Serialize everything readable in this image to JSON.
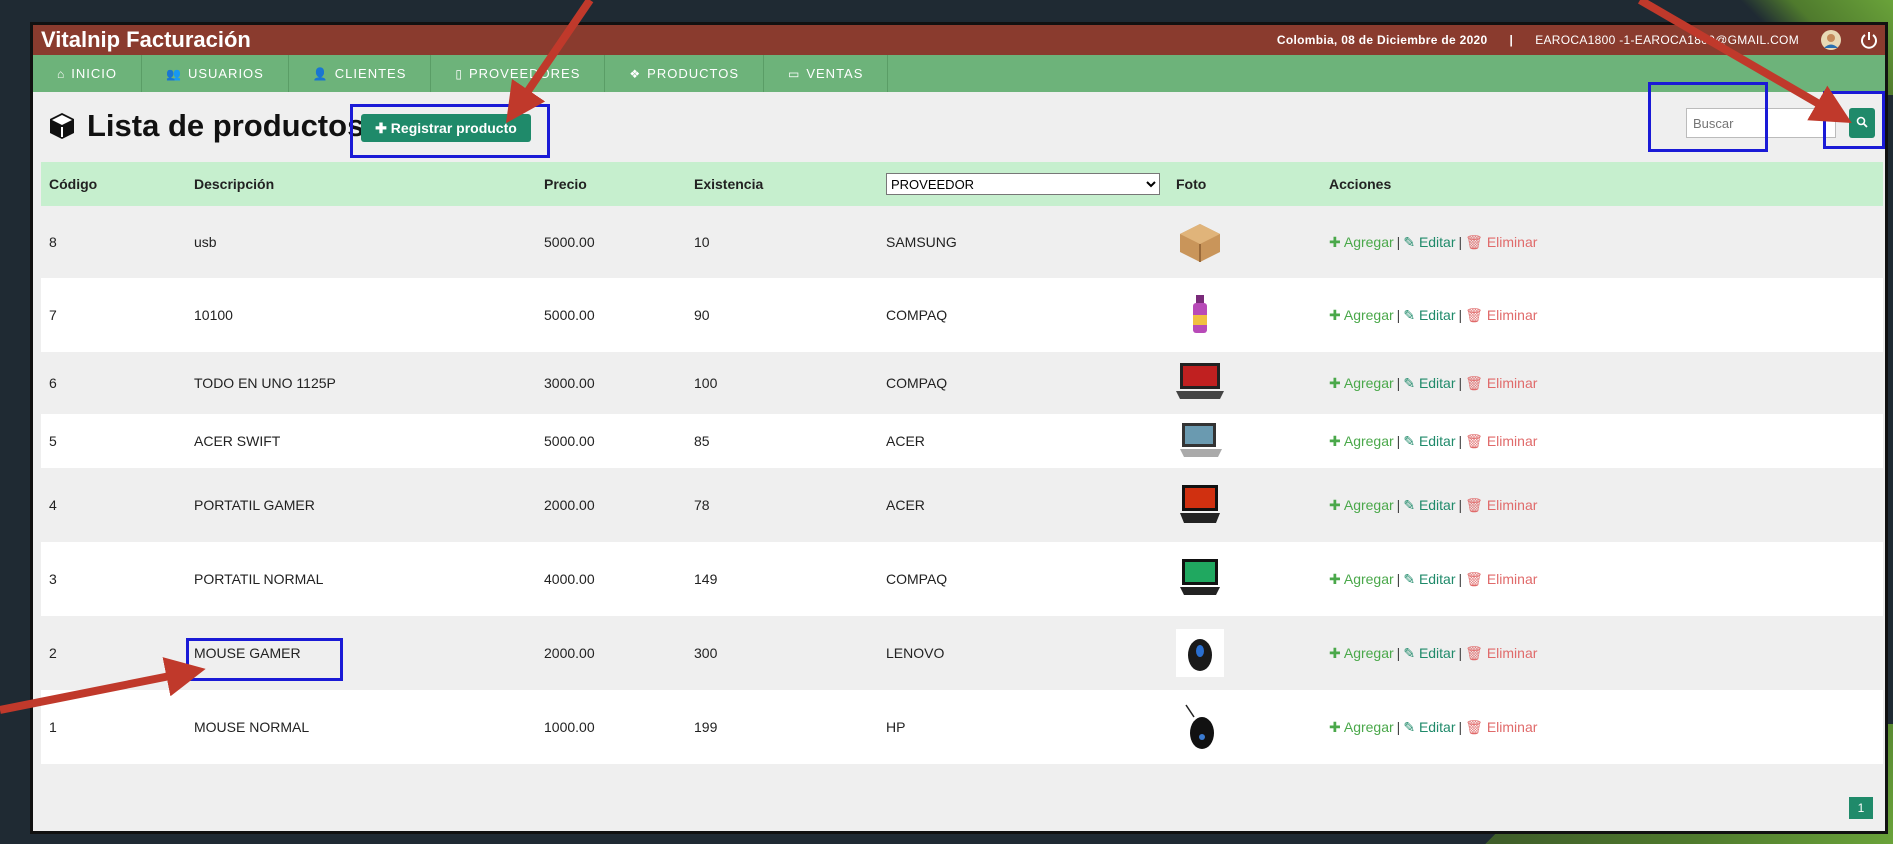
{
  "app": {
    "title": "Vitalnip Facturación",
    "date": "Colombia, 08 de Diciembre de 2020",
    "separator": "|",
    "user": "EAROCA1800 -1-EAROCA1800@GMAIL.COM"
  },
  "nav": [
    {
      "label": "INICIO",
      "icon": "home-icon"
    },
    {
      "label": "USUARIOS",
      "icon": "users-icon"
    },
    {
      "label": "CLIENTES",
      "icon": "user-icon"
    },
    {
      "label": "PROVEEDORES",
      "icon": "building-icon"
    },
    {
      "label": "PRODUCTOS",
      "icon": "cubes-icon"
    },
    {
      "label": "VENTAS",
      "icon": "file-icon"
    }
  ],
  "page": {
    "title": "Lista de productos",
    "register_label": "Registrar producto",
    "search_placeholder": "Buscar"
  },
  "table": {
    "headers": [
      "Código",
      "Descripción",
      "Precio",
      "Existencia",
      "Foto",
      "Acciones"
    ],
    "provider_filter": "PROVEEDOR",
    "actions": {
      "add": "Agregar",
      "edit": "Editar",
      "delete": "Eliminar",
      "sep": "|"
    },
    "rows": [
      {
        "code": "8",
        "description": "usb",
        "price": "5000.00",
        "stock": "10",
        "provider": "SAMSUNG",
        "photo": "cardboard-box"
      },
      {
        "code": "7",
        "description": "10100",
        "price": "5000.00",
        "stock": "90",
        "provider": "COMPAQ",
        "photo": "bottle"
      },
      {
        "code": "6",
        "description": "TODO EN UNO 1125P",
        "price": "3000.00",
        "stock": "100",
        "provider": "COMPAQ",
        "photo": "laptop-red-screen"
      },
      {
        "code": "5",
        "description": "ACER SWIFT",
        "price": "5000.00",
        "stock": "85",
        "provider": "ACER",
        "photo": "laptop-silver"
      },
      {
        "code": "4",
        "description": "PORTATIL GAMER",
        "price": "2000.00",
        "stock": "78",
        "provider": "ACER",
        "photo": "laptop-gamer"
      },
      {
        "code": "3",
        "description": "PORTATIL NORMAL",
        "price": "4000.00",
        "stock": "149",
        "provider": "COMPAQ",
        "photo": "laptop-green-screen"
      },
      {
        "code": "2",
        "description": "MOUSE GAMER",
        "price": "2000.00",
        "stock": "300",
        "provider": "LENOVO",
        "photo": "mouse-gamer"
      },
      {
        "code": "1",
        "description": "MOUSE NORMAL",
        "price": "1000.00",
        "stock": "199",
        "provider": "HP",
        "photo": "mouse-black"
      }
    ]
  },
  "pagination": {
    "current": "1"
  },
  "colors": {
    "topbar": "#8a3b2e",
    "navbar": "#6db37a",
    "accent": "#1f8a6a",
    "header_row": "#c6efce",
    "annotation_box": "#1a1ad6",
    "annotation_arrow": "#c0392b"
  }
}
